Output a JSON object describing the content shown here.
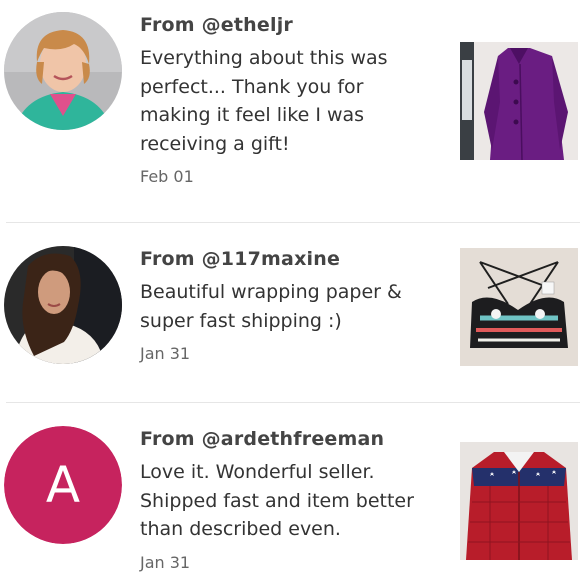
{
  "reviews": [
    {
      "from": "From @etheljr",
      "message": "Everything about this was\nperfect... Thank you for\nmaking it feel like I was\nreceiving a gift!",
      "date": "Feb 01",
      "avatar": "photo",
      "item": "purple coat"
    },
    {
      "from": "From @117maxine",
      "message": "Beautiful wrapping paper &\nsuper fast shipping :)",
      "date": "Jan 31",
      "avatar": "photo",
      "item": "patterned bikini top"
    },
    {
      "from": "From @ardethfreeman",
      "message": "Love it. Wonderful seller.\nShipped fast and item better\nthan described even.",
      "date": "Jan 31",
      "avatar_letter": "A",
      "avatar_color": "#c6235e",
      "item": "red plaid jacket with flag yoke"
    }
  ]
}
